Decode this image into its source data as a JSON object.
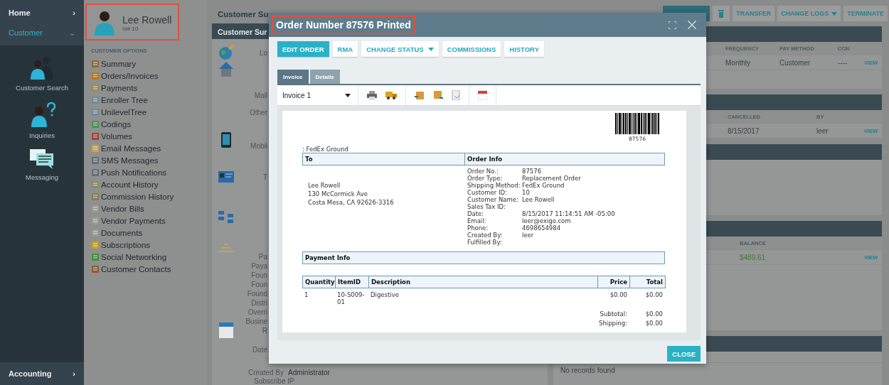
{
  "sidebar": {
    "items": [
      {
        "label": "Home",
        "chevron": "›",
        "selected": false
      },
      {
        "label": "Customer",
        "chevron": "⌄",
        "selected": true
      }
    ],
    "apps": [
      {
        "label": "Customer Search",
        "kind": "people"
      },
      {
        "label": "Inquiries",
        "kind": "question"
      },
      {
        "label": "Messaging",
        "kind": "messages"
      }
    ],
    "footer": {
      "label": "Accounting",
      "chevron": "›"
    }
  },
  "customer": {
    "name": "Lee Rowell",
    "id": "Id# 10",
    "highlighted": true
  },
  "options": {
    "title": "CUSTOMER OPTIONS",
    "items": [
      "Summary",
      "Orders/Invoices",
      "Payments",
      "Enroller Tree",
      "UnilevelTree",
      "Codings",
      "Volumes",
      "Email Messages",
      "SMS Messages",
      "Push Notifications",
      "Account History",
      "Commission History",
      "Vendor Bills",
      "Vendor Payments",
      "Documents",
      "Subscriptions",
      "Social Networking",
      "Customer Contacts"
    ]
  },
  "page": {
    "title": "Customer Su",
    "panel_title": "Customer Sur",
    "labels": [
      "Lo",
      "Mail",
      "Other",
      "Mobil",
      "T",
      "Pa",
      "Paya",
      "Foun",
      "Foun",
      "Found",
      "Distri",
      "Overri",
      "Busine",
      "R",
      "Date"
    ],
    "created_by": {
      "label": "Created By",
      "value": "Administrator"
    },
    "subscribe": "Subscribe IP"
  },
  "toolbar": [
    {
      "kind": "primary"
    },
    {
      "kind": "trash"
    },
    {
      "label": "TRANSFER",
      "kind": "plain"
    },
    {
      "label": "CHANGE LOGS",
      "kind": "dropdown"
    },
    {
      "label": "TERMINATE",
      "kind": "plain"
    }
  ],
  "panels": [
    {
      "columns": [
        "FREQUENCY",
        "PAY METHOD",
        "CCN"
      ],
      "rows": [
        [
          {
            "text": "Monthly",
            "kind": "text"
          },
          {
            "text": "Customer",
            "kind": "text"
          },
          {
            "text": "----",
            "kind": "text"
          },
          {
            "text": "VIEW",
            "kind": "link"
          }
        ]
      ]
    },
    {
      "columns": [
        "CANCELLED",
        "BY"
      ],
      "rows": [
        [
          {
            "text": "8/15/2017",
            "kind": "text"
          },
          {
            "text": "leer",
            "kind": "text"
          },
          {
            "text": "VIEW",
            "kind": "link"
          }
        ]
      ]
    },
    {
      "kind": "blank"
    },
    {
      "columns": [
        "BALANCE"
      ],
      "rows": [
        [
          {
            "text": "$489.61",
            "kind": "money"
          },
          {
            "text": "VIEW",
            "kind": "link"
          }
        ]
      ]
    },
    {
      "message": "No records found"
    }
  ],
  "modal": {
    "title": "Order Number 87576 Printed",
    "highlighted": true,
    "actions": [
      {
        "label": "EDIT ORDER",
        "selected": true,
        "dropdown": false
      },
      {
        "label": "RMA",
        "selected": false,
        "dropdown": false
      },
      {
        "label": "CHANGE STATUS",
        "selected": false,
        "dropdown": true
      },
      {
        "label": "COMMISSIONS",
        "selected": false,
        "dropdown": false
      },
      {
        "label": "HISTORY",
        "selected": false,
        "dropdown": false
      }
    ],
    "tabs": [
      {
        "label": "Invoice",
        "selected": true
      },
      {
        "label": "Details",
        "selected": false
      }
    ],
    "invoice_select": "Invoice 1",
    "invoice": {
      "barcode": "87576",
      "ship_via": ": FedEx Ground",
      "to_header": "To",
      "info_header": "Order Info",
      "address": [
        "Lee Rowell",
        "130 McCormick Ave",
        "Costa Mesa, CA 92626-3316"
      ],
      "info": [
        {
          "label": "Order No.:",
          "value": "87576"
        },
        {
          "label": "Order Type:",
          "value": "Replacement Order"
        },
        {
          "label": "Shipping Method:",
          "value": "FedEx Ground"
        },
        {
          "label": "Customer ID:",
          "value": "10"
        },
        {
          "label": "Customer Name:",
          "value": "Lee Rowell"
        },
        {
          "label": "Sales Tax ID:"
        },
        {
          "label": "Date:",
          "value": "8/15/2017 11:14:51 AM -05:00"
        },
        {
          "label": "Email:",
          "value": "leer@exigo.com"
        },
        {
          "label": "Phone:",
          "value": "4698654984"
        },
        {
          "label": "Created By:",
          "value": "leer"
        },
        {
          "label": "Fulfilled By:"
        }
      ],
      "payment_header": "Payment Info",
      "columns": [
        "Quantity",
        "ItemID",
        "Description",
        "Price",
        "Total"
      ],
      "rows": [
        [
          "1",
          "10-S009-01",
          "Digestive",
          "$0.00",
          "$0.00"
        ]
      ],
      "totals": [
        {
          "label": "Subtotal:",
          "value": "$0.00"
        },
        {
          "label": "Shipping:",
          "value": "$0.00"
        }
      ]
    },
    "close": "CLOSE"
  }
}
